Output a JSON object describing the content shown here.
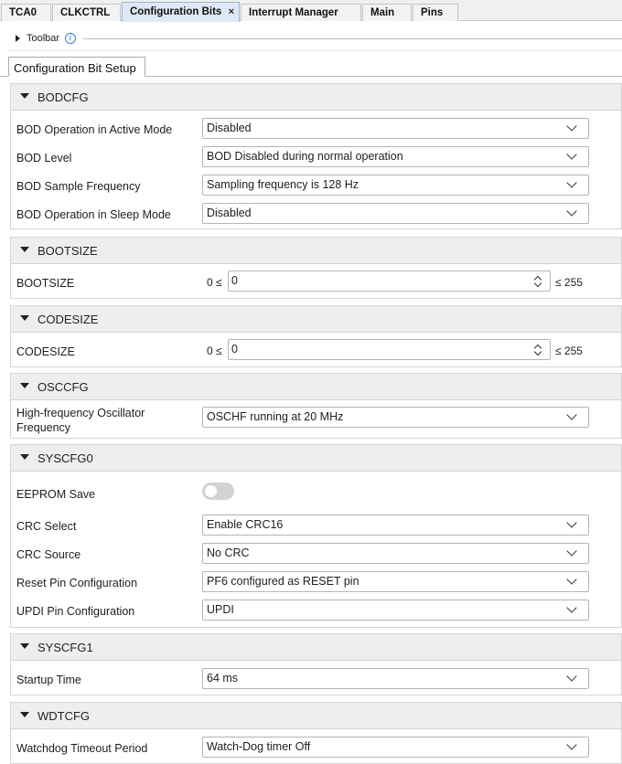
{
  "editor_tabs": [
    {
      "label": "TCA0"
    },
    {
      "label": "CLKCTRL"
    },
    {
      "label": "Configuration Bits",
      "active": true,
      "closable": true
    },
    {
      "label": "Interrupt Manager"
    },
    {
      "label": "Main"
    },
    {
      "label": "Pins"
    }
  ],
  "close_glyph": "×",
  "toolbar": {
    "label": "Toolbar",
    "info_glyph": "i"
  },
  "subtab": {
    "label": "Configuration Bit Setup"
  },
  "sections": {
    "bodcfg": {
      "title": "BODCFG",
      "rows": [
        {
          "label": "BOD Operation in Active Mode",
          "value": "Disabled"
        },
        {
          "label": "BOD Level",
          "value": "BOD Disabled during normal operation"
        },
        {
          "label": "BOD Sample Frequency",
          "value": "Sampling frequency is 128 Hz"
        },
        {
          "label": "BOD Operation in Sleep Mode",
          "value": "Disabled"
        }
      ]
    },
    "bootsize": {
      "title": "BOOTSIZE",
      "row": {
        "label": "BOOTSIZE",
        "min_text": "0 ≤",
        "value": "0",
        "max_text": "≤ 255"
      }
    },
    "codesize": {
      "title": "CODESIZE",
      "row": {
        "label": "CODESIZE",
        "min_text": "0 ≤",
        "value": "0",
        "max_text": "≤ 255"
      }
    },
    "osccfg": {
      "title": "OSCCFG",
      "row": {
        "label_line1": "High-frequency Oscillator",
        "label_line2": "Frequency",
        "value": "OSCHF running at 20 MHz"
      }
    },
    "syscfg0": {
      "title": "SYSCFG0",
      "eeprom": {
        "label": "EEPROM Save",
        "enabled": false
      },
      "rows": [
        {
          "label": "CRC Select",
          "value": "Enable CRC16"
        },
        {
          "label": "CRC Source",
          "value": "No CRC"
        },
        {
          "label": "Reset Pin Configuration",
          "value": "PF6 configured as RESET pin"
        },
        {
          "label": "UPDI Pin Configuration",
          "value": "UPDI"
        }
      ]
    },
    "syscfg1": {
      "title": "SYSCFG1",
      "row": {
        "label": "Startup Time",
        "value": "64 ms"
      }
    },
    "wdtcfg": {
      "title": "WDTCFG",
      "row": {
        "label": "Watchdog Timeout Period",
        "value": "Watch-Dog timer Off"
      }
    }
  }
}
